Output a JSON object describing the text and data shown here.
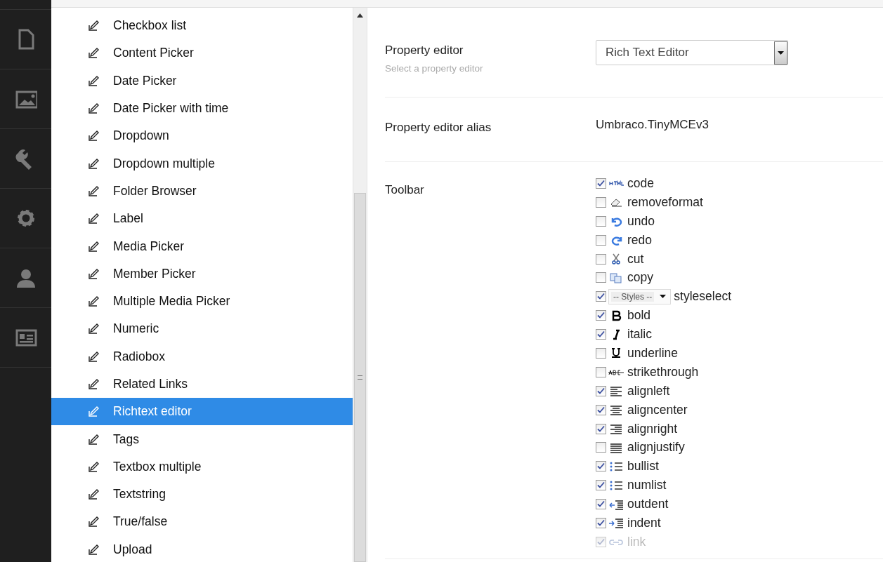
{
  "nav": [
    {
      "selected": false
    },
    {
      "selected": false
    },
    {
      "selected": false
    },
    {
      "selected": false
    },
    {
      "selected": false
    },
    {
      "selected": false
    }
  ],
  "tree": [
    {
      "label": "Checkbox list",
      "selected": false
    },
    {
      "label": "Content Picker",
      "selected": false
    },
    {
      "label": "Date Picker",
      "selected": false
    },
    {
      "label": "Date Picker with time",
      "selected": false
    },
    {
      "label": "Dropdown",
      "selected": false
    },
    {
      "label": "Dropdown multiple",
      "selected": false
    },
    {
      "label": "Folder Browser",
      "selected": false
    },
    {
      "label": "Label",
      "selected": false
    },
    {
      "label": "Media Picker",
      "selected": false
    },
    {
      "label": "Member Picker",
      "selected": false
    },
    {
      "label": "Multiple Media Picker",
      "selected": false
    },
    {
      "label": "Numeric",
      "selected": false
    },
    {
      "label": "Radiobox",
      "selected": false
    },
    {
      "label": "Related Links",
      "selected": false
    },
    {
      "label": "Richtext editor",
      "selected": true
    },
    {
      "label": "Tags",
      "selected": false
    },
    {
      "label": "Textbox multiple",
      "selected": false
    },
    {
      "label": "Textstring",
      "selected": false
    },
    {
      "label": "True/false",
      "selected": false
    },
    {
      "label": "Upload",
      "selected": false
    }
  ],
  "property_editor": {
    "label": "Property editor",
    "description": "Select a property editor",
    "value": "Rich Text Editor"
  },
  "alias": {
    "label": "Property editor alias",
    "value": "Umbraco.TinyMCEv3"
  },
  "toolbar": {
    "label": "Toolbar",
    "items": [
      {
        "kind": "button",
        "label": "code",
        "checked": true,
        "disabled": false
      },
      {
        "kind": "button",
        "label": "removeformat",
        "checked": false,
        "disabled": false
      },
      {
        "kind": "button",
        "label": "undo",
        "checked": false,
        "disabled": false
      },
      {
        "kind": "button",
        "label": "redo",
        "checked": false,
        "disabled": false
      },
      {
        "kind": "button",
        "label": "cut",
        "checked": false,
        "disabled": false
      },
      {
        "kind": "button",
        "label": "copy",
        "checked": false,
        "disabled": false
      },
      {
        "kind": "select",
        "label": "styleselect",
        "select_text": "-- Styles --",
        "checked": true,
        "disabled": false
      },
      {
        "kind": "button",
        "label": "bold",
        "checked": true,
        "disabled": false
      },
      {
        "kind": "button",
        "label": "italic",
        "checked": true,
        "disabled": false
      },
      {
        "kind": "button",
        "label": "underline",
        "checked": false,
        "disabled": false
      },
      {
        "kind": "button",
        "label": "strikethrough",
        "checked": false,
        "disabled": false
      },
      {
        "kind": "button",
        "label": "alignleft",
        "checked": true,
        "disabled": false
      },
      {
        "kind": "button",
        "label": "aligncenter",
        "checked": true,
        "disabled": false
      },
      {
        "kind": "button",
        "label": "alignright",
        "checked": true,
        "disabled": false
      },
      {
        "kind": "button",
        "label": "alignjustify",
        "checked": false,
        "disabled": false
      },
      {
        "kind": "button",
        "label": "bullist",
        "checked": true,
        "disabled": false
      },
      {
        "kind": "button",
        "label": "numlist",
        "checked": true,
        "disabled": false
      },
      {
        "kind": "button",
        "label": "outdent",
        "checked": true,
        "disabled": false
      },
      {
        "kind": "button",
        "label": "indent",
        "checked": true,
        "disabled": false
      },
      {
        "kind": "button",
        "label": "link",
        "checked": true,
        "disabled": true
      }
    ]
  }
}
